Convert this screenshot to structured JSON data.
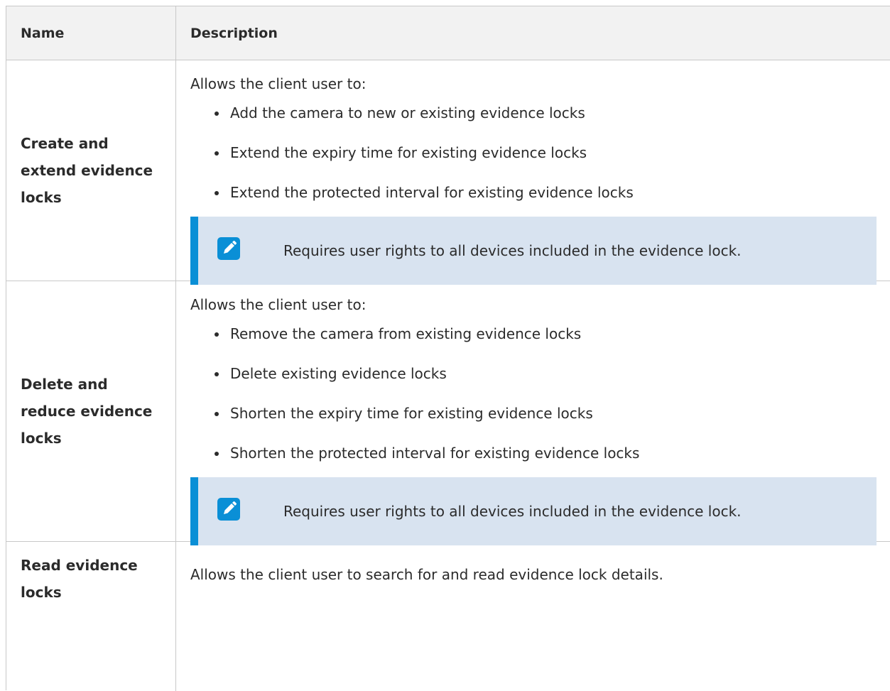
{
  "table": {
    "headers": {
      "name": "Name",
      "description": "Description"
    },
    "rows": [
      {
        "name": "Create and extend evidence locks",
        "intro": "Allows the client user to:",
        "bullets": [
          "Add the camera to new or existing evidence locks",
          "Extend the expiry time for existing evidence locks",
          "Extend the protected interval for existing evidence locks"
        ],
        "note": "Requires user rights to all devices included in the evidence lock."
      },
      {
        "name": "Delete and reduce evidence locks",
        "intro": "Allows the client user to:",
        "bullets": [
          "Remove the camera from existing evidence locks",
          "Delete existing evidence locks",
          "Shorten the expiry time for existing evidence locks",
          "Shorten the protected interval for existing evidence locks"
        ],
        "note": "Requires user rights to all devices included in the evidence lock."
      },
      {
        "name": "Read evidence locks",
        "description": "Allows the client user to search for and read evidence lock details."
      }
    ]
  },
  "colors": {
    "note_accent": "#0a8fd6",
    "note_background": "#d8e3f0",
    "header_background": "#f2f2f2",
    "grid_line": "#c8c8c8"
  },
  "icons": {
    "note": "pencil-icon"
  }
}
